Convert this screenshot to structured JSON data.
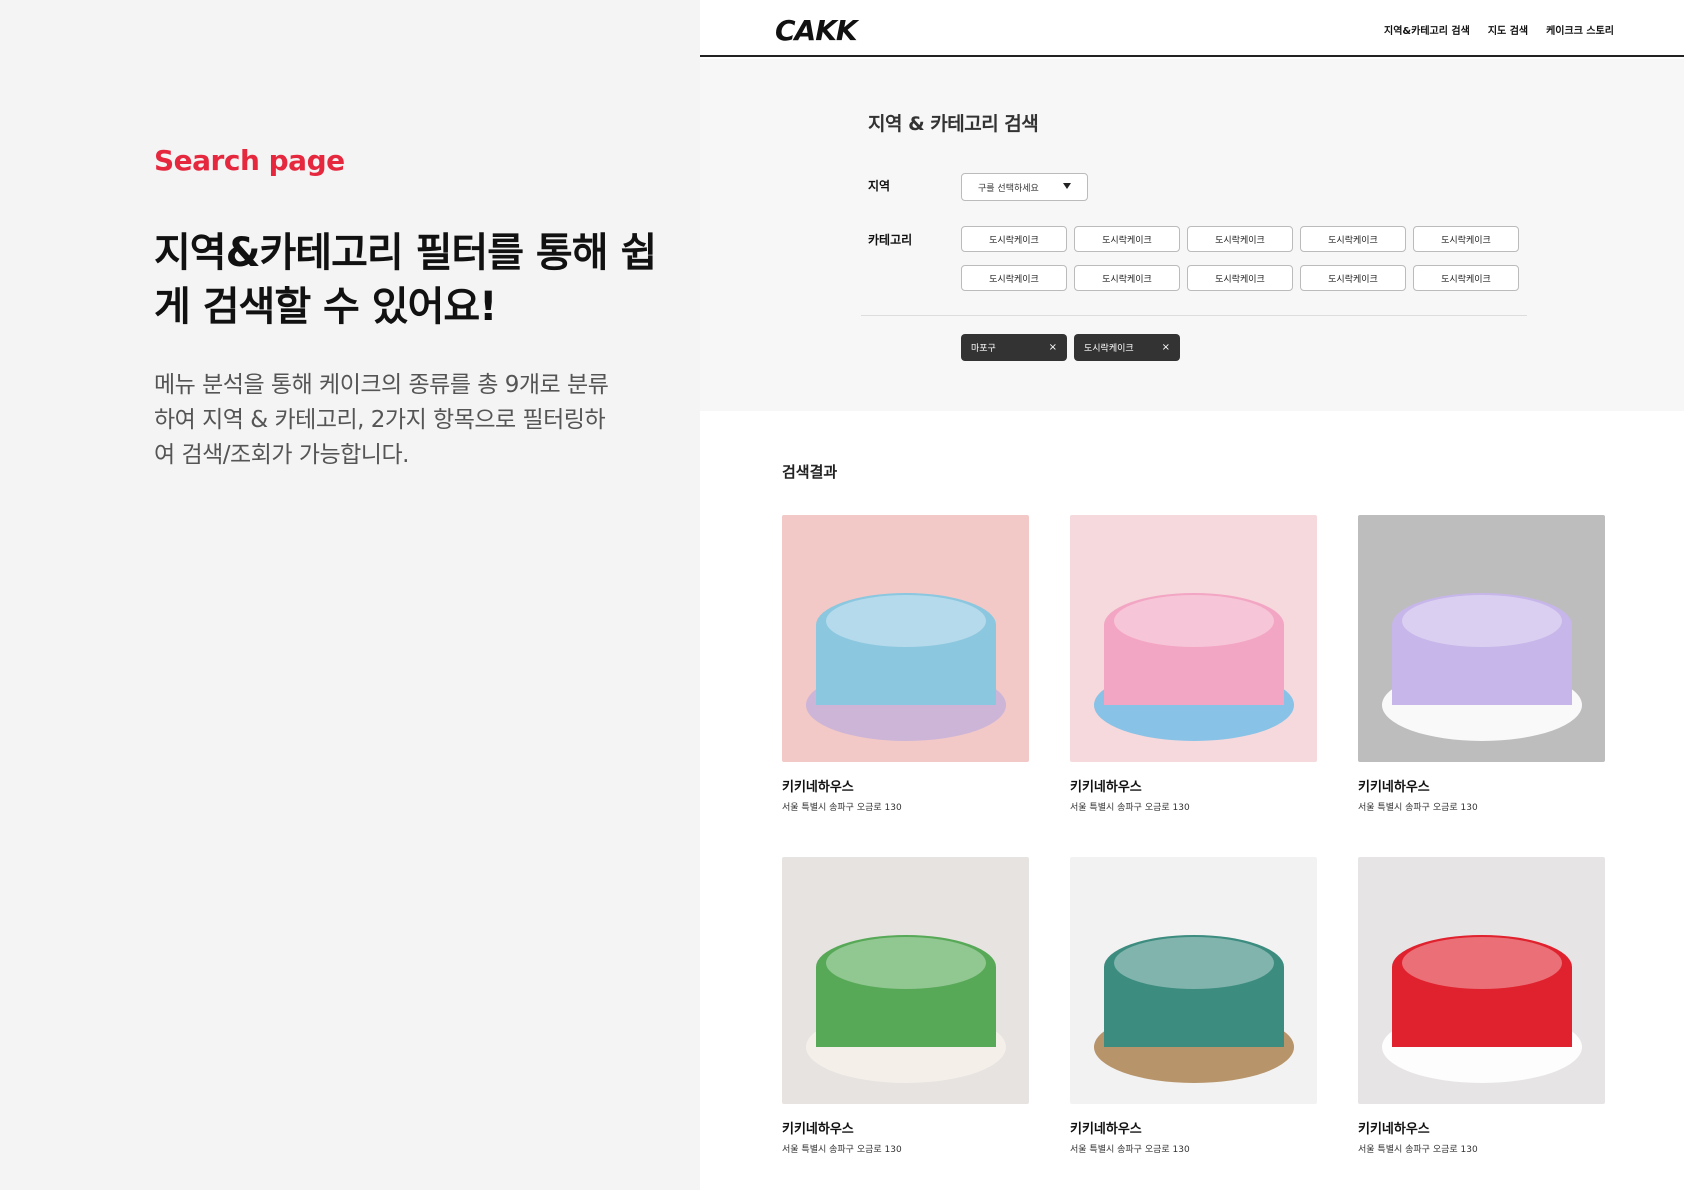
{
  "intro": {
    "eyebrow": "Search page",
    "heading": "지역&카테고리 필터를 통해 쉽게 검색할 수 있어요!",
    "body": "메뉴 분석을 통해 케이크의 종류를 총 9개로 분류하여 지역 & 카테고리, 2가지 항목으로 필터링하여 검색/조회가 가능합니다."
  },
  "nav": {
    "logo": "CAKK",
    "links": [
      "지역&카테고리 검색",
      "지도 검색",
      "케이크크 스토리"
    ]
  },
  "filter": {
    "title": "지역 & 카테고리 검색",
    "region_label": "지역",
    "region_placeholder": "구를 선택하세요",
    "category_label": "카테고리",
    "categories": [
      "도시락케이크",
      "도시락케이크",
      "도시락케이크",
      "도시락케이크",
      "도시락케이크",
      "도시락케이크",
      "도시락케이크",
      "도시락케이크",
      "도시락케이크",
      "도시락케이크"
    ],
    "selected_tags": [
      "마포구",
      "도시락케이크"
    ],
    "close_glyph": "×"
  },
  "results": {
    "title": "검색결과",
    "items": [
      {
        "name": "키키네하우스",
        "address": "서울 특별시 송파구 오금로 130",
        "colors": [
          "#f2c9c6",
          "#8cc7e0",
          "#c9b3d9"
        ]
      },
      {
        "name": "키키네하우스",
        "address": "서울 특별시 송파구 오금로 130",
        "colors": [
          "#f5d9dc",
          "#f3a6c3",
          "#7cc0e8"
        ]
      },
      {
        "name": "키키네하우스",
        "address": "서울 특별시 송파구 오금로 130",
        "colors": [
          "#bdbdbd",
          "#c7b6ea",
          "#ffffff"
        ]
      },
      {
        "name": "키키네하우스",
        "address": "서울 특별시 송파구 오금로 130",
        "colors": [
          "#e6e3e0",
          "#57a957",
          "#f5f0ea"
        ]
      },
      {
        "name": "키키네하우스",
        "address": "서울 특별시 송파구 오금로 130",
        "colors": [
          "#f2f2f2",
          "#3d8c80",
          "#b08a5a"
        ]
      },
      {
        "name": "키키네하우스",
        "address": "서울 특별시 송파구 오금로 130",
        "colors": [
          "#e7e4e6",
          "#e0222e",
          "#ffffff"
        ]
      }
    ]
  },
  "colors": {
    "accent": "#e6283f",
    "tag_bg": "#333333"
  }
}
